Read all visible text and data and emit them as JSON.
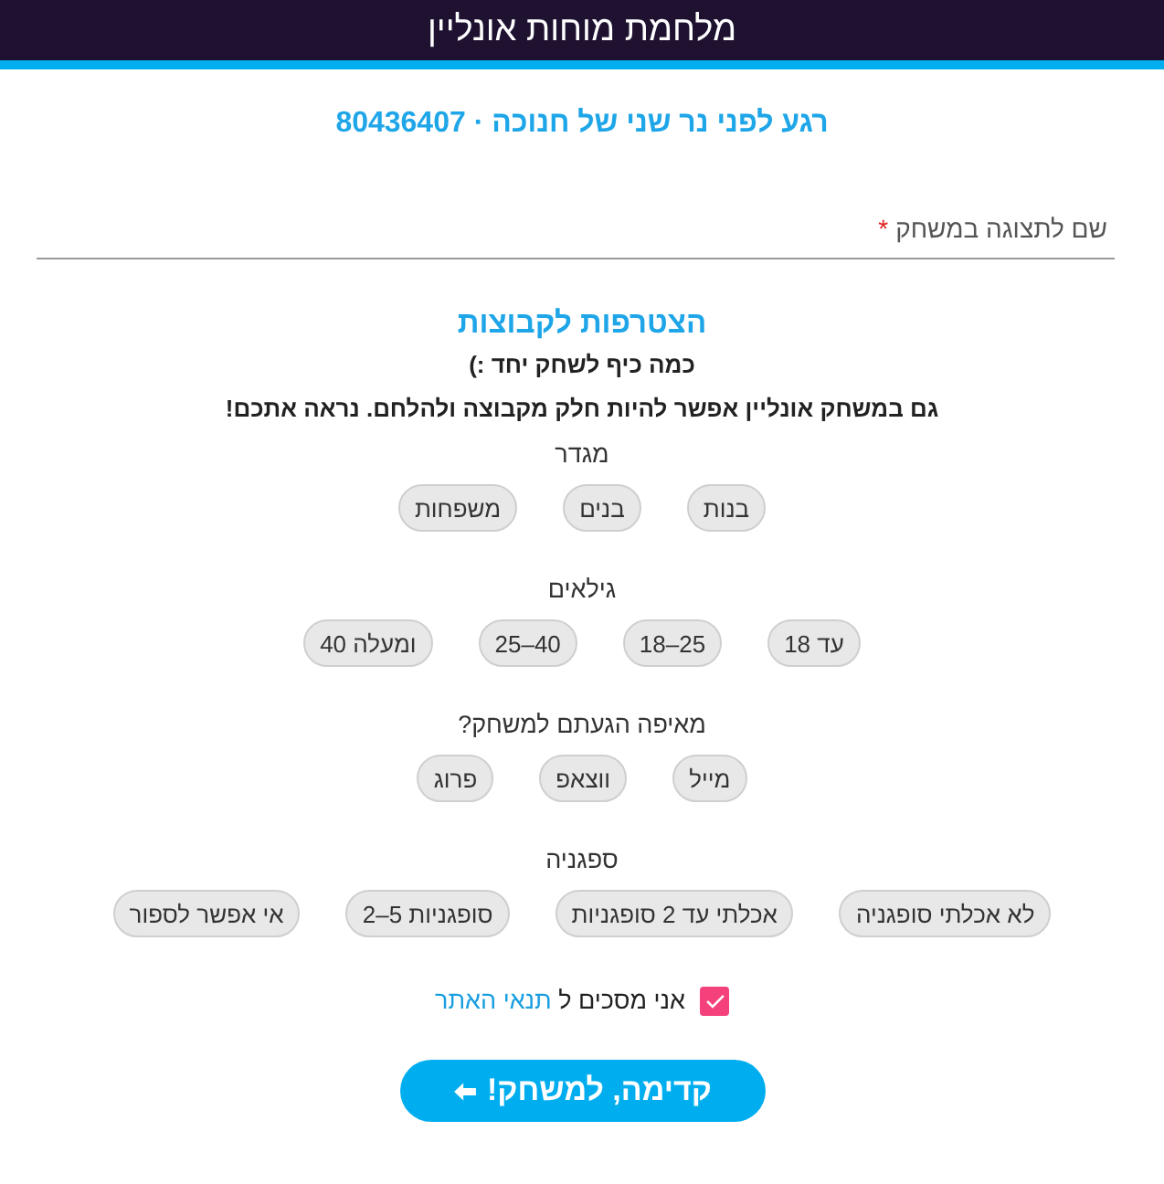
{
  "header": {
    "title": "מלחמת מוחות אונליין"
  },
  "game_title": "רגע לפני נר שני של חנוכה · 80436407",
  "name_field": {
    "placeholder": "שם לתצוגה במשחק",
    "required_mark": "*"
  },
  "join": {
    "title": "הצטרפות לקבוצות",
    "lines": [
      "כמה כיף לשחק יחד :)",
      "גם במשחק אונליין אפשר להיות חלק מקבוצה ולהלחם. נראה אתכם!"
    ],
    "groups": [
      {
        "label": "מגדר",
        "options": [
          {
            "label": "בנות",
            "selected": false
          },
          {
            "label": "בנים",
            "selected": false
          },
          {
            "label": "משפחות",
            "selected": false
          }
        ]
      },
      {
        "label": "גילאים",
        "options": [
          {
            "label": "עד 18",
            "selected": false
          },
          {
            "label": "18–25",
            "selected": false
          },
          {
            "label": "25–40",
            "selected": false
          },
          {
            "label": "40 ומעלה",
            "selected": false
          }
        ]
      },
      {
        "label": "מאיפה הגעתם למשחק?",
        "options": [
          {
            "label": "מייל",
            "selected": false
          },
          {
            "label": "ווצאפ",
            "selected": false
          },
          {
            "label": "פרוג",
            "selected": false
          }
        ]
      },
      {
        "label": "ספגניה",
        "options": [
          {
            "label": "לא אכלתי סופגניה",
            "selected": false
          },
          {
            "label": "אכלתי עד 2 סופגניות",
            "selected": false
          },
          {
            "label": "2–5 סופגניות",
            "selected": false
          },
          {
            "label": "אי אפשר לספור",
            "selected": false
          }
        ]
      }
    ]
  },
  "terms": {
    "checked": true,
    "text": "אני מסכים ל",
    "link": "תנאי האתר"
  },
  "submit": {
    "label": "קדימה, למשחק!"
  }
}
